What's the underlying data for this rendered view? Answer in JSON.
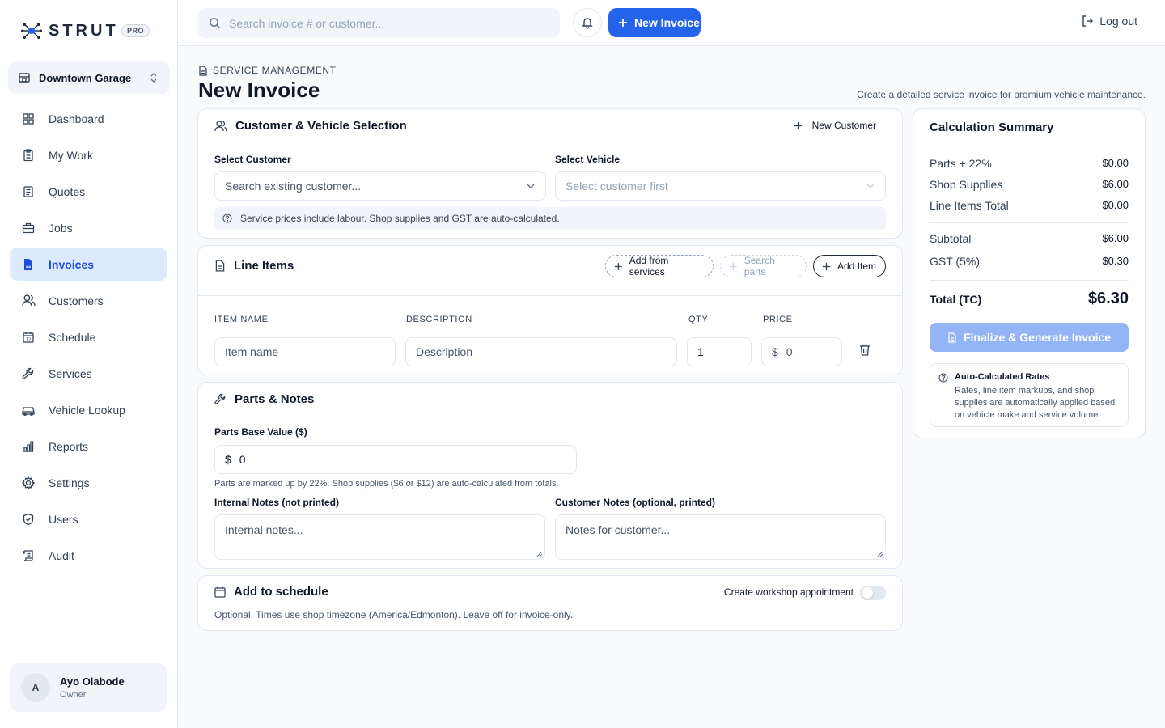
{
  "brand": {
    "name": "STRUT",
    "badge": "PRO"
  },
  "shop": {
    "name": "Downtown Garage"
  },
  "nav": [
    {
      "label": "Dashboard",
      "icon": "grid-icon"
    },
    {
      "label": "My Work",
      "icon": "clipboard-icon"
    },
    {
      "label": "Quotes",
      "icon": "document-list-icon"
    },
    {
      "label": "Jobs",
      "icon": "briefcase-icon"
    },
    {
      "label": "Invoices",
      "icon": "file-icon",
      "active": true
    },
    {
      "label": "Customers",
      "icon": "users-icon"
    },
    {
      "label": "Schedule",
      "icon": "calendar-icon"
    },
    {
      "label": "Services",
      "icon": "wrench-icon"
    },
    {
      "label": "Vehicle Lookup",
      "icon": "car-icon"
    },
    {
      "label": "Reports",
      "icon": "bar-chart-icon"
    },
    {
      "label": "Settings",
      "icon": "gear-icon"
    },
    {
      "label": "Users",
      "icon": "shield-icon"
    },
    {
      "label": "Audit",
      "icon": "scroll-icon"
    }
  ],
  "user": {
    "initial": "A",
    "name": "Ayo Olabode",
    "role": "Owner"
  },
  "topbar": {
    "search_placeholder": "Search invoice # or customer...",
    "new_invoice_label": "New Invoice",
    "logout_label": "Log out"
  },
  "page": {
    "breadcrumb": "SERVICE MANAGEMENT",
    "title": "New Invoice",
    "subtitle": "Create a detailed service invoice for premium vehicle maintenance."
  },
  "customer_section": {
    "title": "Customer & Vehicle Selection",
    "new_customer_label": "New Customer",
    "customer_label": "Select Customer",
    "customer_placeholder": "Search existing customer...",
    "vehicle_label": "Select Vehicle",
    "vehicle_placeholder": "Select customer first",
    "info": "Service prices include labour. Shop supplies and GST are auto-calculated."
  },
  "line_items": {
    "title": "Line Items",
    "add_from_services": "Add from services",
    "search_parts": "Search parts",
    "add_item": "Add Item",
    "columns": {
      "name": "ITEM NAME",
      "description": "DESCRIPTION",
      "qty": "QTY",
      "price": "PRICE"
    },
    "row": {
      "name_placeholder": "Item name",
      "description_placeholder": "Description",
      "qty": "1",
      "currency": "$",
      "price": "0"
    }
  },
  "parts_notes": {
    "title": "Parts & Notes",
    "parts_label": "Parts Base Value ($)",
    "currency": "$",
    "parts_value": "0",
    "parts_hint": "Parts are marked up by 22%. Shop supplies ($6 or $12) are auto-calculated from totals.",
    "internal_label": "Internal Notes (not printed)",
    "internal_placeholder": "Internal notes...",
    "customer_label": "Customer Notes (optional, printed)",
    "customer_placeholder": "Notes for customer..."
  },
  "schedule": {
    "title": "Add to schedule",
    "toggle_label": "Create workshop appointment",
    "toggle_on": false,
    "hint": "Optional. Times use shop timezone (America/Edmonton). Leave off for invoice-only."
  },
  "summary": {
    "title": "Calculation Summary",
    "rows_top": [
      {
        "label": "Parts + 22%",
        "value": "$0.00"
      },
      {
        "label": "Shop Supplies",
        "value": "$6.00"
      },
      {
        "label": "Line Items Total",
        "value": "$0.00"
      }
    ],
    "rows_mid": [
      {
        "label": "Subtotal",
        "value": "$6.00"
      },
      {
        "label": "GST (5%)",
        "value": "$0.30"
      }
    ],
    "total_label": "Total (TC)",
    "total_value": "$6.30",
    "finalize_label": "Finalize & Generate Invoice",
    "rates_title": "Auto-Calculated Rates",
    "rates_desc": "Rates, line item markups, and shop supplies are automatically applied based on vehicle make and service volume."
  },
  "colors": {
    "accent": "#2563eb",
    "active_bg": "#dbeafe",
    "disabled_btn": "#93b4f5"
  }
}
